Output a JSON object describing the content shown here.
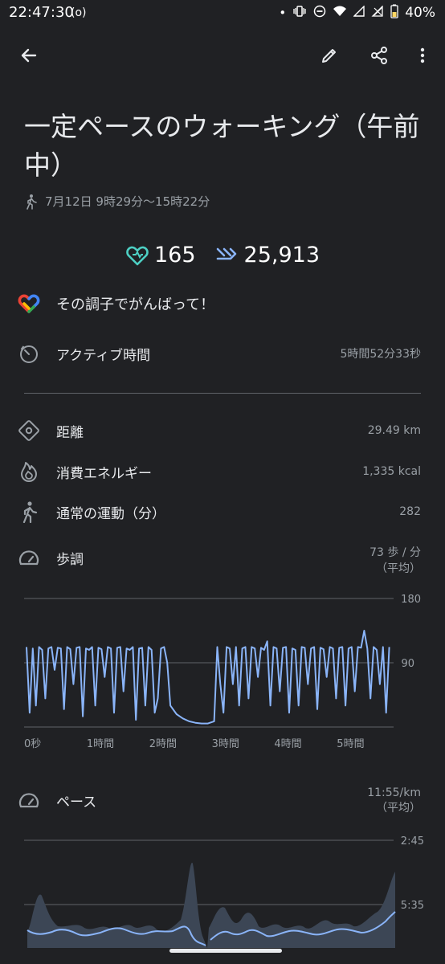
{
  "status": {
    "time": "22:47:30",
    "left_icon": "(o)",
    "battery": "40%"
  },
  "toolbar": {
    "back_icon": "arrow-left-icon",
    "edit_icon": "pencil-icon",
    "share_icon": "share-icon",
    "more_icon": "more-vert-icon"
  },
  "activity": {
    "title": "一定ペースのウォーキング（午前中）",
    "subtitle": "7月12日 9時29分～15時22分"
  },
  "metrics": {
    "heart_pts": "165",
    "steps": "25,913"
  },
  "encourage": "その調子でがんばって！",
  "stats": {
    "active_time": {
      "label": "アクティブ時間",
      "value": "5時間52分33秒"
    },
    "distance": {
      "label": "距離",
      "value": "29.49 km"
    },
    "energy": {
      "label": "消費エネルギー",
      "value": "1,335 kcal"
    },
    "move_minutes": {
      "label": "通常の運動（分）",
      "value": "282"
    },
    "cadence": {
      "label": "歩調",
      "value_line1": "73 歩 / 分",
      "value_line2": "（平均）"
    },
    "pace": {
      "label": "ペース",
      "value_line1": "11:55/km",
      "value_line2": "（平均）"
    }
  },
  "colors": {
    "background": "#202124",
    "accent_green": "#4dd0c4",
    "accent_blue": "#8ab4f8",
    "chart_line": "#8ab4f8",
    "pace_fill": "#3c4655"
  },
  "chart_data": [
    {
      "type": "line",
      "name": "cadence",
      "ylim": [
        0,
        180
      ],
      "yticks": [
        "180",
        "90"
      ],
      "xticks": [
        "0秒",
        "1時間",
        "2時間",
        "3時間",
        "4時間",
        "5時間"
      ],
      "x_hours": [
        0,
        0.05,
        0.1,
        0.15,
        0.2,
        0.25,
        0.3,
        0.35,
        0.4,
        0.45,
        0.5,
        0.55,
        0.6,
        0.65,
        0.7,
        0.75,
        0.8,
        0.85,
        0.9,
        0.95,
        1.0,
        1.05,
        1.1,
        1.15,
        1.2,
        1.25,
        1.3,
        1.35,
        1.4,
        1.45,
        1.5,
        1.55,
        1.6,
        1.65,
        1.7,
        1.75,
        1.8,
        1.85,
        1.9,
        1.95,
        2.0,
        2.05,
        2.1,
        2.15,
        2.2,
        2.25,
        2.3,
        2.4,
        2.5,
        2.6,
        2.7,
        2.8,
        2.9,
        3.0,
        3.05,
        3.1,
        3.15,
        3.2,
        3.25,
        3.3,
        3.35,
        3.4,
        3.45,
        3.5,
        3.55,
        3.6,
        3.65,
        3.7,
        3.75,
        3.8,
        3.85,
        3.9,
        3.95,
        4.0,
        4.05,
        4.1,
        4.15,
        4.2,
        4.25,
        4.3,
        4.35,
        4.4,
        4.45,
        4.5,
        4.55,
        4.6,
        4.65,
        4.7,
        4.75,
        4.8,
        4.85,
        4.9,
        4.95,
        5.0,
        5.05,
        5.1,
        5.15,
        5.2,
        5.25,
        5.3,
        5.35,
        5.4,
        5.45,
        5.5,
        5.55,
        5.6,
        5.65,
        5.7,
        5.75,
        5.8
      ],
      "values": [
        112,
        20,
        110,
        30,
        112,
        108,
        40,
        110,
        112,
        80,
        111,
        110,
        25,
        112,
        109,
        60,
        111,
        112,
        15,
        110,
        108,
        112,
        30,
        111,
        109,
        70,
        112,
        110,
        20,
        111,
        112,
        50,
        110,
        108,
        112,
        10,
        110,
        111,
        30,
        112,
        108,
        20,
        40,
        110,
        112,
        90,
        30,
        18,
        12,
        8,
        6,
        5,
        5,
        8,
        112,
        60,
        20,
        112,
        110,
        60,
        112,
        30,
        110,
        112,
        40,
        112,
        110,
        70,
        111,
        108,
        120,
        30,
        112,
        110,
        50,
        111,
        112,
        20,
        110,
        108,
        30,
        112,
        111,
        60,
        110,
        112,
        25,
        111,
        109,
        70,
        112,
        110,
        40,
        111,
        112,
        30,
        110,
        112,
        50,
        112,
        111,
        135,
        110,
        40,
        112,
        108,
        60,
        112,
        20,
        112
      ]
    },
    {
      "type": "area",
      "name": "pace",
      "yticks": [
        "2:45",
        "5:35"
      ]
    }
  ]
}
